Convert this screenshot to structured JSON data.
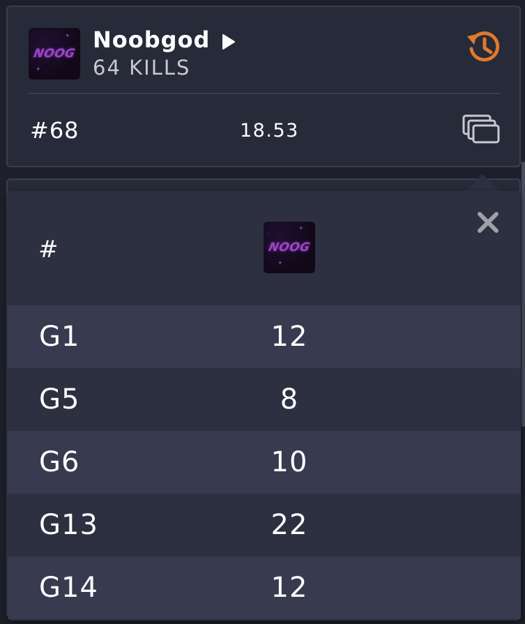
{
  "player": {
    "name": "Noobgod",
    "kills_label": "64 KILLS",
    "rank": "#68",
    "score": "18.53",
    "avatar_text": "NOOG"
  },
  "popup": {
    "header": {
      "game_col": "#"
    },
    "rows": [
      {
        "game": "G1",
        "kills": "12"
      },
      {
        "game": "G5",
        "kills": "8"
      },
      {
        "game": "G6",
        "kills": "10"
      },
      {
        "game": "G13",
        "kills": "22"
      },
      {
        "game": "G14",
        "kills": "12"
      }
    ]
  },
  "colors": {
    "background": "#1d1f2b",
    "card": "#272a39",
    "popup": "#2d3040",
    "row_alt": "#383b4f",
    "accent_orange": "#e07a2a",
    "avatar_purple": "#9a47c6"
  },
  "icons": {
    "play": "play-icon",
    "history": "history-icon",
    "windows": "windows-icon",
    "close": "close-icon"
  }
}
